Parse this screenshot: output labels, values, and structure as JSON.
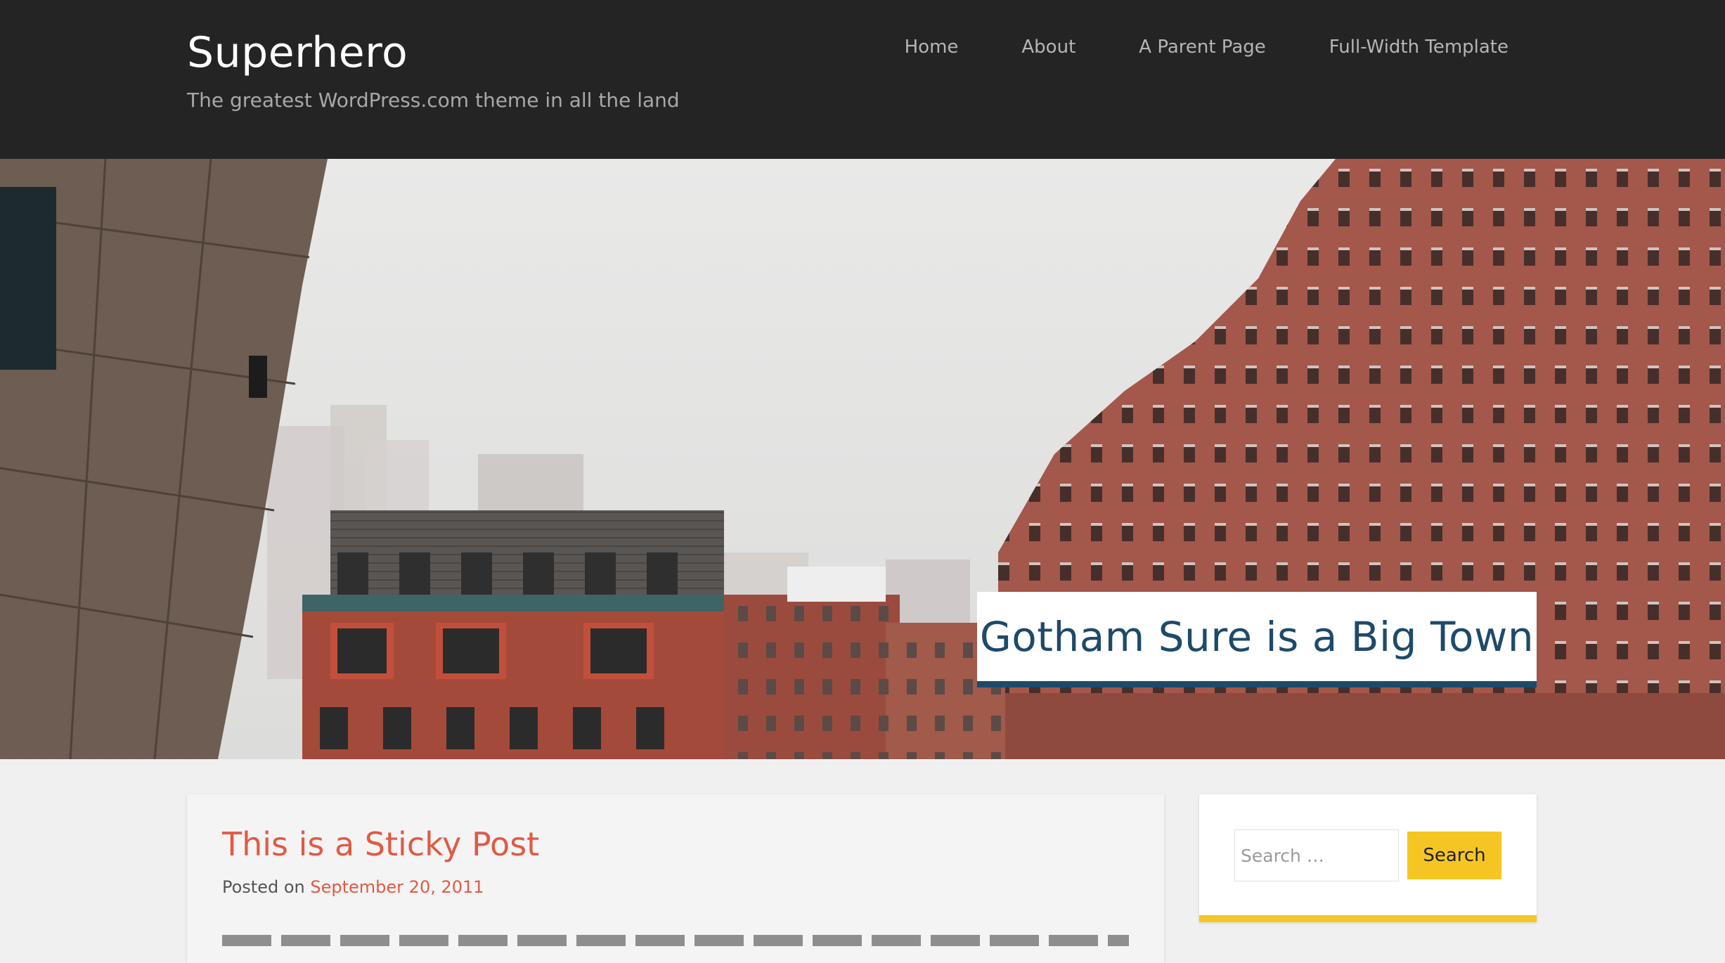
{
  "site": {
    "title": "Superhero",
    "tagline": "The greatest WordPress.com theme in all the land"
  },
  "nav": {
    "items": [
      {
        "label": "Home"
      },
      {
        "label": "About"
      },
      {
        "label": "A Parent Page"
      },
      {
        "label": "Full-Width Template"
      }
    ]
  },
  "hero": {
    "image": "foggy-city-buildings",
    "caption": "Gotham Sure is a Big Town"
  },
  "post": {
    "title": "This is a Sticky Post",
    "meta_prefix": "Posted on",
    "date": "September 20, 2011"
  },
  "sidebar": {
    "search": {
      "placeholder": "Search …",
      "value": "",
      "button_label": "Search"
    }
  },
  "colors": {
    "header_bg": "#242424",
    "caption_accent": "#1e4a6a",
    "link_accent": "#e05a44",
    "widget_accent": "#f5c623"
  }
}
